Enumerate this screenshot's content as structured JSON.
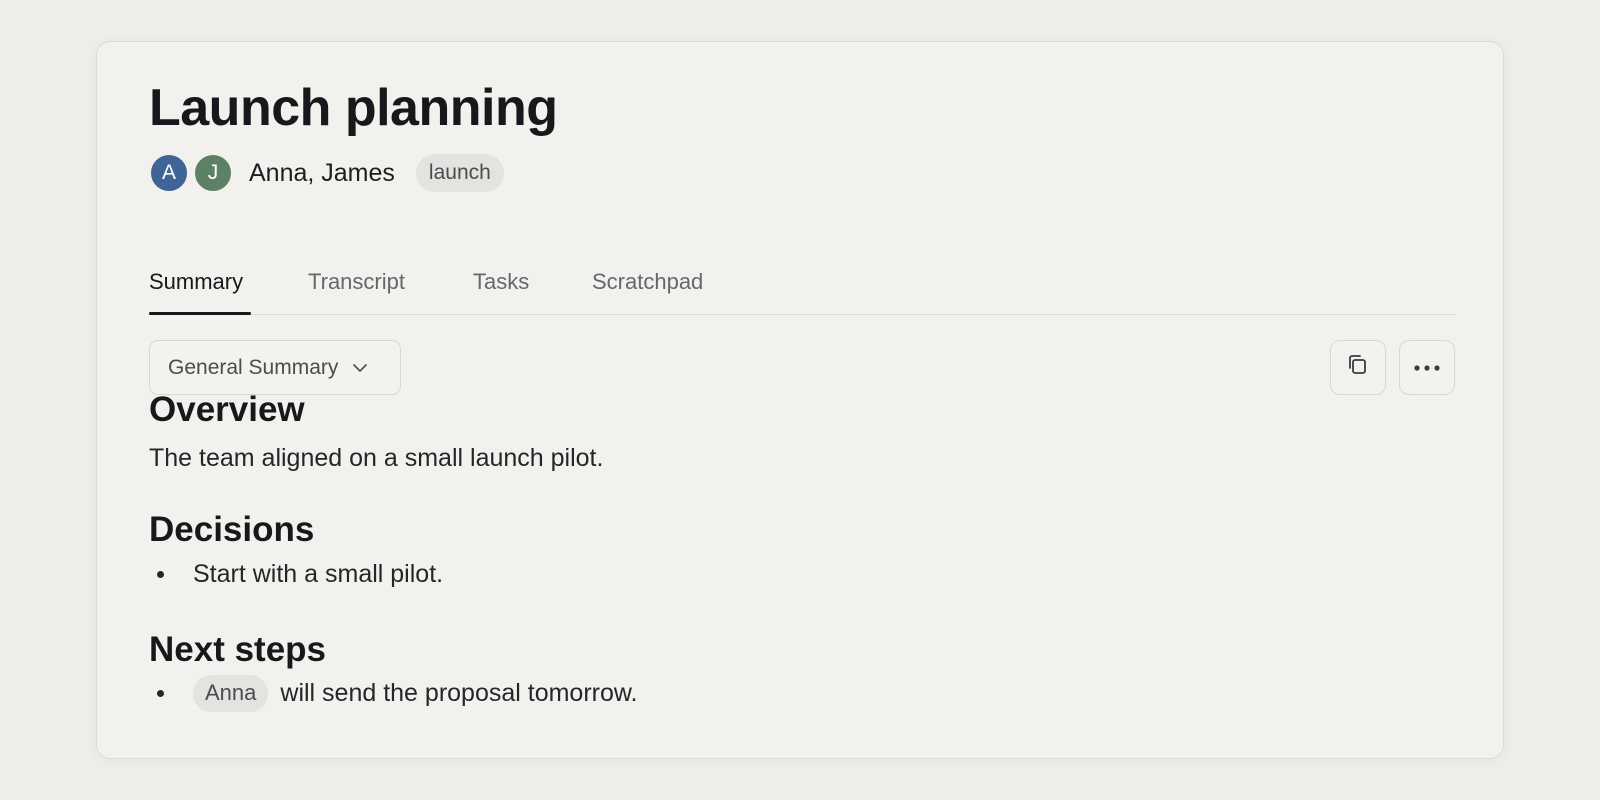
{
  "meeting": {
    "title": "Launch planning",
    "participants": [
      {
        "initial": "A",
        "color": "#3f6597"
      },
      {
        "initial": "J",
        "color": "#5c8165"
      }
    ],
    "participant_names": "Anna, James",
    "tag": "launch"
  },
  "tabs": [
    {
      "label": "Summary",
      "active": true
    },
    {
      "label": "Transcript",
      "active": false
    },
    {
      "label": "Tasks",
      "active": false
    },
    {
      "label": "Scratchpad",
      "active": false
    }
  ],
  "toolbar": {
    "summary_type": "General Summary",
    "summary_type_icon": "chevron-down-icon",
    "copy_icon": "copy-icon",
    "more_icon": "more-horizontal-icon"
  },
  "summary": {
    "overview": {
      "heading": "Overview",
      "text": "The team aligned on a small launch pilot."
    },
    "decisions": {
      "heading": "Decisions",
      "items": [
        "Start with a small pilot."
      ]
    },
    "next_steps": {
      "heading": "Next steps",
      "items": [
        {
          "mention": "Anna",
          "text": "will send the proposal tomorrow."
        }
      ]
    }
  },
  "colors": {
    "background": "#efeeea",
    "card": "#f2f1ed",
    "text": "#17181c",
    "muted": "#66676c"
  }
}
